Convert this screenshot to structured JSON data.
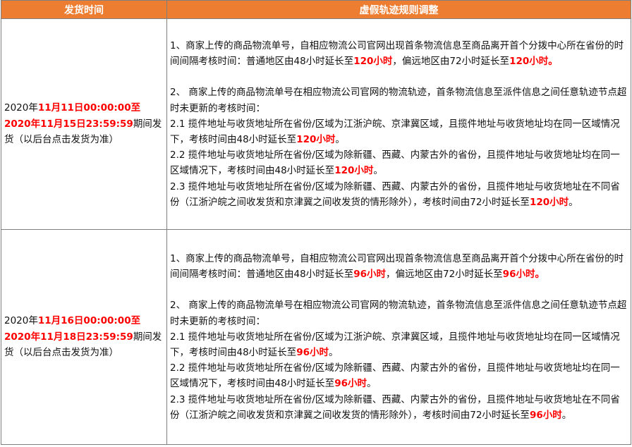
{
  "header": {
    "col1": "发货时间",
    "col2": "虚假轨迹规则调整"
  },
  "rows": [
    {
      "time": {
        "prefix": "2020年",
        "start": "11月11日00:00:00至",
        "end": "2020年11月15日23:59:59",
        "suffix": "期间发货（以后台点击发货为准）"
      },
      "rules": {
        "r1_text": " 1、商家上传的商品物流单号，自相应物流公司官网出现首条物流信息至商品离开首个分拨中心所在省份的时间间隔考核时间：普通地区由48小时延长至",
        "r1_val1": "120小时",
        "r1_mid": "，偏远地区由72小时延长至",
        "r1_val2": "120小时。",
        "r2_text": "2、 商家上传的商品物流单号在相应物流公司官网的物流轨迹，首条物流信息至派件信息之间任意轨迹节点超时未更新的考核时间：",
        "r21_text": "2.1 揽件地址与收货地址所在省份/区域为江浙沪皖、京津冀区域，且揽件地址与收货地址均在同一区域情况下，考核时间由48小时延长至",
        "r21_val": "120小时",
        "r21_end": "。",
        "r22_text": "2.2 揽件地址与收货地址所在省份/区域为除新疆、西藏、内蒙古外的省份，且揽件地址与收货地址均在同一区域情况下，考核时间由48小时延长至",
        "r22_val": "120小时",
        "r22_end": "。",
        "r23_text": "2.3 揽件地址与收货地址所在省份/区域为除新疆、西藏、内蒙古外的省份，且揽件地址与收货地址在不同省份（江浙沪皖之间收发货和京津冀之间收发货的情形除外），考核时间由72小时延长至",
        "r23_val": "120小时",
        "r23_end": "。"
      }
    },
    {
      "time": {
        "prefix": "2020年",
        "start": "11月16日00:00:00至",
        "end": "2020年11月18日23:59:59",
        "suffix": "期间发货（以后台点击发货为准）"
      },
      "rules": {
        "r1_text": " 1、商家上传的商品物流单号，自相应物流公司官网出现首条物流信息至商品离开首个分拨中心所在省份的时间间隔考核时间：普通地区由48小时延长至",
        "r1_val1": "96小时",
        "r1_mid": "，偏远地区由72小时延长至",
        "r1_val2": "96小时。",
        "r2_text": "2、 商家上传的商品物流单号在相应物流公司官网的物流轨迹，首条物流信息至派件信息之间任意轨迹节点超时未更新的考核时间：",
        "r21_text": "2.1 揽件地址与收货地址所在省份/区域为江浙沪皖、京津冀区域，且揽件地址与收货地址均在同一区域情况下，考核时间由48小时延长至",
        "r21_val": "96小时",
        "r21_end": "。",
        "r22_text": "2.2 揽件地址与收货地址所在省份/区域为除新疆、西藏、内蒙古外的省份，且揽件地址与收货地址均在同一区域情况下，考核时间由48小时延长至",
        "r22_val": "96小时",
        "r22_end": "。",
        "r23_text": "2.3 揽件地址与收货地址所在省份/区域为除新疆、西藏、内蒙古外的省份，且揽件地址与收货地址在不同省份（江浙沪皖之间收发货和京津冀之间收发货的情形除外），考核时间由72小时延长至",
        "r23_val": "96小时",
        "r23_end": "。"
      }
    }
  ],
  "colors": {
    "header_bg": "#ed7d31",
    "header_text": "#ffffff",
    "highlight": "#ff0000",
    "border": "#7f7f7f"
  }
}
